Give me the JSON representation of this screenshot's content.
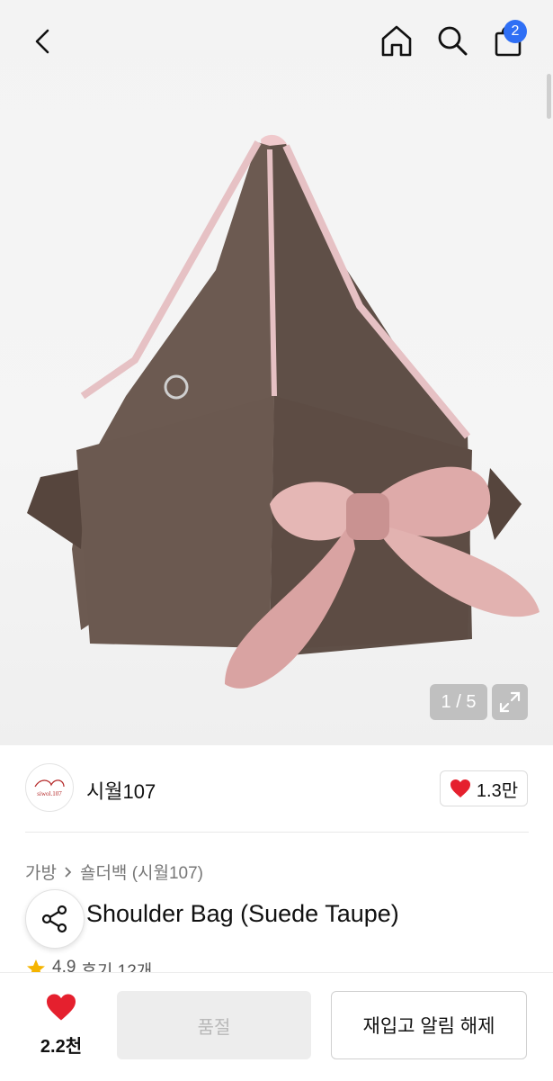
{
  "header": {
    "cart_count": "2"
  },
  "gallery": {
    "counter": "1 / 5",
    "brand_mark": "ꙮ"
  },
  "store": {
    "logo_text": "siwol.107",
    "name": "시월107",
    "likes": "1.3만"
  },
  "breadcrumb": {
    "items": [
      "가방",
      "숄더백 (시월107)"
    ]
  },
  "product": {
    "title": "Shoulder Bag (Suede Taupe)",
    "rating": "4.9",
    "reviews": "후기 12개"
  },
  "bottom": {
    "wish_count": "2.2천",
    "soldout_label": "품절",
    "restock_label": "재입고 알림 해제"
  },
  "colors": {
    "accent": "#2f6ff5",
    "heart": "#e5202e"
  }
}
